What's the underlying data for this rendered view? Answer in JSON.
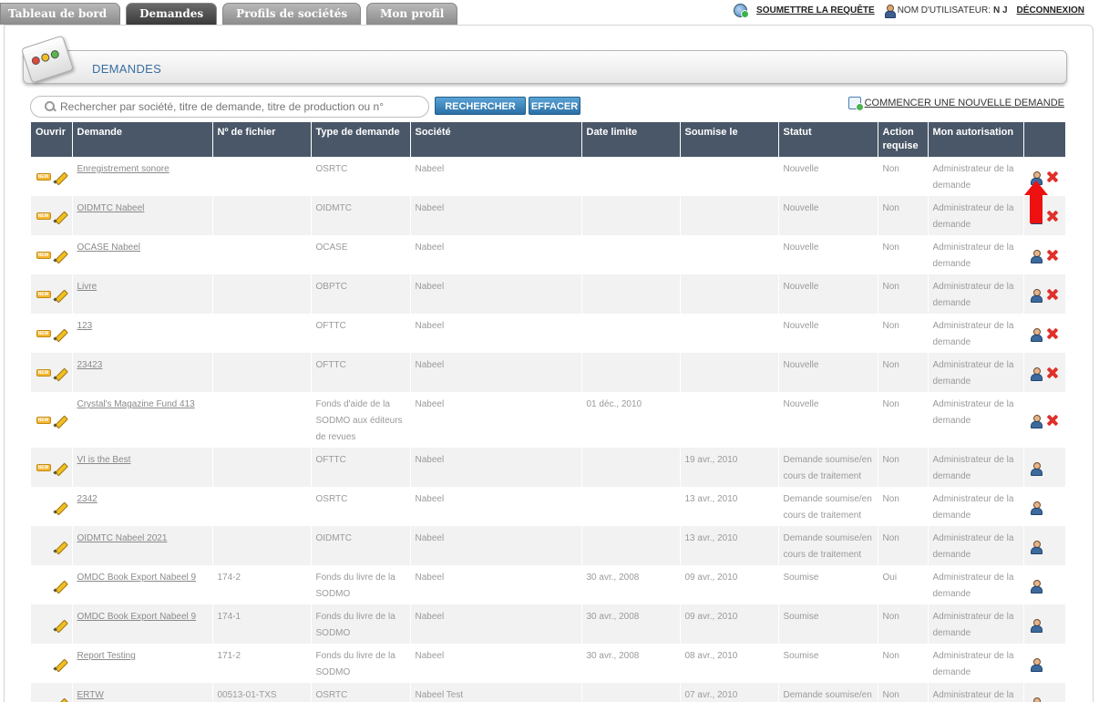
{
  "nav": {
    "tabs": [
      {
        "label": "Tableau de bord"
      },
      {
        "label": "Demandes"
      },
      {
        "label": "Profils de sociétés"
      },
      {
        "label": "Mon profil"
      }
    ],
    "submit_label": "SOUMETTRE LA REQUÊTE",
    "username_label": "NOM D'UTILISATEUR:",
    "username_value": "N J",
    "logout_label": "DÉCONNEXION"
  },
  "section": {
    "title": "DEMANDES"
  },
  "search": {
    "placeholder": "Rechercher par société, titre de demande, titre de production ou n°",
    "search_button": "RECHERCHER",
    "clear_button": "EFFACER",
    "new_request_label": "COMMENCER UNE NOUVELLE DEMANDE"
  },
  "table": {
    "headers": [
      "Ouvrir",
      "Demande",
      "Nº de fichier",
      "Type de demande",
      "Société",
      "Date limite",
      "Soumise le",
      "Statut",
      "Action requise",
      "Mon autorisation",
      ""
    ],
    "rows": [
      {
        "is_new": true,
        "request": "Enregistrement sonore",
        "file_no": "",
        "type": "OSRTC",
        "company": "Nabeel",
        "deadline": "",
        "submitted": "",
        "status": "Nouvelle",
        "action": "Non",
        "authorization": "Administrateur de la demande",
        "deletable": true
      },
      {
        "is_new": true,
        "request": "OIDMTC Nabeel",
        "file_no": "",
        "type": "OIDMTC",
        "company": "Nabeel",
        "deadline": "",
        "submitted": "",
        "status": "Nouvelle",
        "action": "Non",
        "authorization": "Administrateur de la demande",
        "deletable": true
      },
      {
        "is_new": true,
        "request": "OCASE Nabeel",
        "file_no": "",
        "type": "OCASE",
        "company": "Nabeel",
        "deadline": "",
        "submitted": "",
        "status": "Nouvelle",
        "action": "Non",
        "authorization": "Administrateur de la demande",
        "deletable": true
      },
      {
        "is_new": true,
        "request": "Livre",
        "file_no": "",
        "type": "OBPTC",
        "company": "Nabeel",
        "deadline": "",
        "submitted": "",
        "status": "Nouvelle",
        "action": "Non",
        "authorization": "Administrateur de la demande",
        "deletable": true
      },
      {
        "is_new": true,
        "request": "123",
        "file_no": "",
        "type": "OFTTC",
        "company": "Nabeel",
        "deadline": "",
        "submitted": "",
        "status": "Nouvelle",
        "action": "Non",
        "authorization": "Administrateur de la demande",
        "deletable": true
      },
      {
        "is_new": true,
        "request": "23423",
        "file_no": "",
        "type": "OFTTC",
        "company": "Nabeel",
        "deadline": "",
        "submitted": "",
        "status": "Nouvelle",
        "action": "Non",
        "authorization": "Administrateur de la demande",
        "deletable": true
      },
      {
        "is_new": true,
        "request": "Crystal's Magazine Fund 413",
        "file_no": "",
        "type": "Fonds d'aide de la SODMO aux éditeurs de revues",
        "company": "Nabeel",
        "deadline": "01 déc., 2010",
        "submitted": "",
        "status": "Nouvelle",
        "action": "Non",
        "authorization": "Administrateur de la demande",
        "deletable": true
      },
      {
        "is_new": true,
        "request": "VI is the Best",
        "file_no": "",
        "type": "OFTTC",
        "company": "Nabeel",
        "deadline": "",
        "submitted": "19 avr., 2010",
        "status": "Demande soumise/en cours de traitement",
        "action": "Non",
        "authorization": "Administrateur de la demande",
        "deletable": false
      },
      {
        "is_new": false,
        "request": "2342",
        "file_no": "",
        "type": "OSRTC",
        "company": "Nabeel",
        "deadline": "",
        "submitted": "13 avr., 2010",
        "status": "Demande soumise/en cours de traitement",
        "action": "Non",
        "authorization": "Administrateur de la demande",
        "deletable": false
      },
      {
        "is_new": false,
        "request": "OIDMTC Nabeel 2021",
        "file_no": "",
        "type": "OIDMTC",
        "company": "Nabeel",
        "deadline": "",
        "submitted": "13 avr., 2010",
        "status": "Demande soumise/en cours de traitement",
        "action": "Non",
        "authorization": "Administrateur de la demande",
        "deletable": false
      },
      {
        "is_new": false,
        "request": "OMDC Book Export Nabeel 9",
        "file_no": "174-2",
        "type": "Fonds du livre de la SODMO",
        "company": "Nabeel",
        "deadline": "30 avr., 2008",
        "submitted": "09 avr., 2010",
        "status": "Soumise",
        "action": "Oui",
        "authorization": "Administrateur de la demande",
        "deletable": false
      },
      {
        "is_new": false,
        "request": "OMDC Book Export Nabeel 9",
        "file_no": "174-1",
        "type": "Fonds du livre de la SODMO",
        "company": "Nabeel",
        "deadline": "30 avr., 2008",
        "submitted": "09 avr., 2010",
        "status": "Soumise",
        "action": "Non",
        "authorization": "Administrateur de la demande",
        "deletable": false
      },
      {
        "is_new": false,
        "request": "Report Testing",
        "file_no": "171-2",
        "type": "Fonds du livre de la SODMO",
        "company": "Nabeel",
        "deadline": "30 avr., 2008",
        "submitted": "08 avr., 2010",
        "status": "Soumise",
        "action": "Non",
        "authorization": "Administrateur de la demande",
        "deletable": false
      },
      {
        "is_new": false,
        "request": "ERTW",
        "file_no": "00513-01-TXS",
        "type": "OSRTC",
        "company": "Nabeel Test",
        "deadline": "",
        "submitted": "07 avr., 2010",
        "status": "Demande soumise/en cours de traitement",
        "action": "Non",
        "authorization": "Administrateur de la demande",
        "deletable": false
      }
    ]
  },
  "new_icon_text": "NEW",
  "colors": {
    "header_bg": "#4a5768",
    "accent_blue": "#2a6fa5",
    "delete_red": "#e0302a",
    "annotation_arrow": "#ee1111"
  }
}
